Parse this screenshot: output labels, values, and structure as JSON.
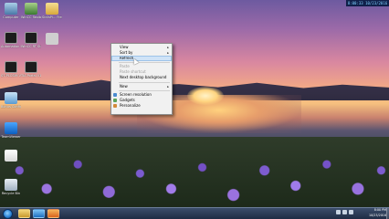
{
  "overlay": {
    "time_date": "8:00:33 10/23/2016"
  },
  "desktop_icons": [
    {
      "label": "Computer",
      "icon": "computer-icon"
    },
    {
      "label": "WinCC flexible...",
      "icon": "shield-icon"
    },
    {
      "label": "SinfaPl... Free Calen",
      "icon": "folder-icon"
    },
    {
      "label": "Automation License M...",
      "icon": "license-icon"
    },
    {
      "label": "WinCC RT Start",
      "icon": "wincc-icon"
    },
    {
      "label": "",
      "icon": "blank-icon"
    },
    {
      "label": "S7-PLCSIM V13",
      "icon": "plcsim-icon"
    },
    {
      "label": "TIA Portal V13",
      "icon": "tia-icon"
    },
    {
      "label": "Bonus Configurator",
      "icon": "configurator-icon"
    },
    {
      "label": "TeamViewer",
      "icon": "teamviewer-icon"
    },
    {
      "label": "",
      "icon": "file-icon"
    },
    {
      "label": "Recycle Bin",
      "icon": "recycle-bin-icon"
    }
  ],
  "context_menu": {
    "items": [
      {
        "label": "View",
        "submenu": true,
        "disabled": false
      },
      {
        "label": "Sort by",
        "submenu": true,
        "disabled": false
      },
      {
        "label": "Refresh",
        "submenu": false,
        "disabled": false,
        "highlighted": true
      },
      {
        "label": "Paste",
        "submenu": false,
        "disabled": true
      },
      {
        "label": "Paste shortcut",
        "submenu": false,
        "disabled": true
      },
      {
        "label": "Next desktop background",
        "submenu": false,
        "disabled": false
      },
      {
        "label": "New",
        "submenu": true,
        "disabled": false
      },
      {
        "label": "Screen resolution",
        "submenu": false,
        "disabled": false,
        "icon": "monitor-icon"
      },
      {
        "label": "Gadgets",
        "submenu": false,
        "disabled": false,
        "icon": "gadgets-icon"
      },
      {
        "label": "Personalize",
        "submenu": false,
        "disabled": false,
        "icon": "personalize-icon"
      }
    ]
  },
  "taskbar": {
    "start_icon": "start-icon",
    "apps": [
      "explorer-icon",
      "ie-icon",
      "media-icon"
    ],
    "clock": {
      "time": "8:00 PM",
      "date": "10/23/2016"
    }
  }
}
